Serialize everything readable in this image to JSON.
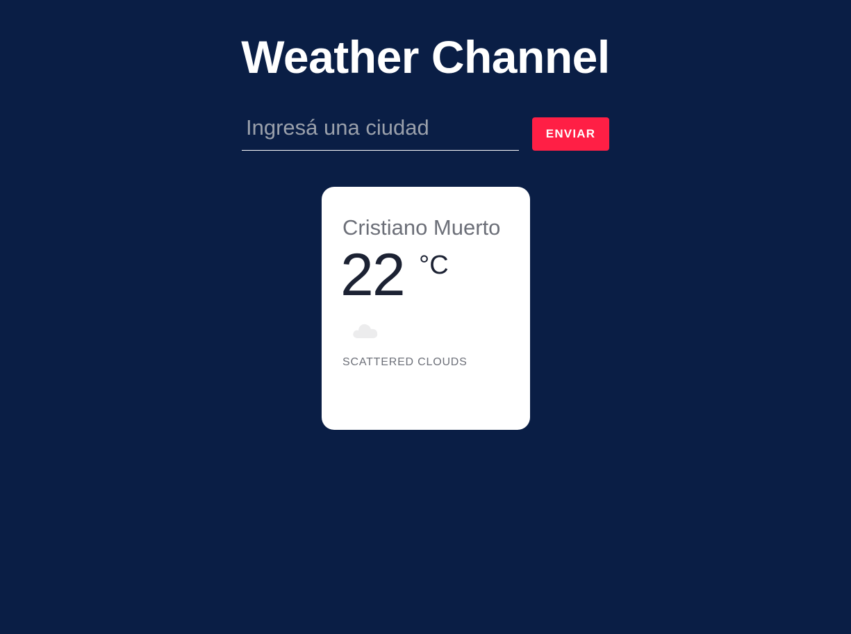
{
  "header": {
    "title": "Weather Channel"
  },
  "search": {
    "placeholder": "Ingresá una ciudad",
    "value": "",
    "submit_label": "ENVIAR"
  },
  "weather_card": {
    "city": "Cristiano Muerto",
    "temperature": "22",
    "unit": "°C",
    "icon": "cloud-icon",
    "description": "SCATTERED CLOUDS"
  },
  "colors": {
    "background": "#0a1e45",
    "accent": "#ff1f45",
    "card": "#ffffff"
  }
}
